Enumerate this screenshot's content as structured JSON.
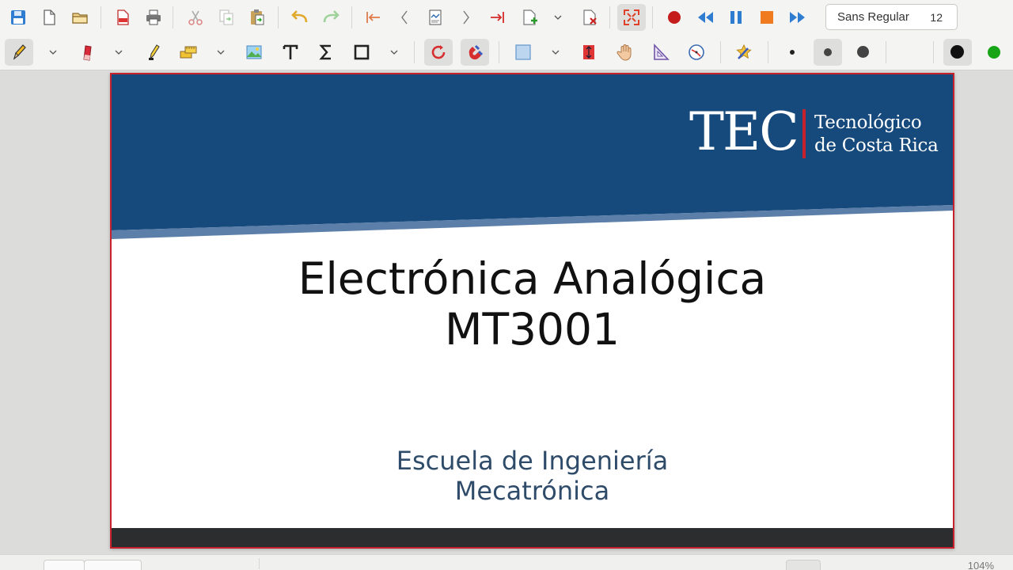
{
  "toolbar_top": {
    "items": [
      "save-icon",
      "new-page-icon",
      "open-folder-icon",
      "export-pdf-icon",
      "print-icon",
      "cut-icon",
      "copy-icon",
      "paste-icon",
      "undo-icon",
      "redo-icon",
      "first-page-icon",
      "previous-page-icon",
      "page-overview-icon",
      "next-page-icon",
      "last-page-icon",
      "add-page-icon",
      "delete-page-icon",
      "fullscreen-icon",
      "record-icon",
      "rewind-icon",
      "pause-icon",
      "stop-icon",
      "fast-forward-icon"
    ],
    "font_name": "Sans Regular",
    "font_size": "12"
  },
  "toolbar_tools": {
    "items": [
      "pen-icon",
      "eraser-icon",
      "highlighter-icon",
      "ruler-select-icon",
      "image-icon",
      "text-tool-icon",
      "formula-icon",
      "shape-icon",
      "rotate-snap-icon",
      "magnet-icon",
      "fill-rectangle-icon",
      "vertical-space-icon",
      "hand-icon",
      "set-square-icon",
      "compass-icon",
      "shape-recognizer-icon"
    ],
    "colors": {
      "purple": "#8f57e0",
      "black": "#111111",
      "green": "#17a517",
      "accent_red": "#c8212e"
    }
  },
  "slide": {
    "logo_letters": "TEC",
    "logo_name_line1": "Tecnológico",
    "logo_name_line2": "de Costa Rica",
    "title_line1": "Electrónica Analógica",
    "title_line2": "MT3001",
    "subtitle_line1": "Escuela de Ingeniería",
    "subtitle_line2": "Mecatrónica",
    "header_color": "#174a7c",
    "border_color": "#c8212e"
  },
  "statusbar": {
    "zoom": "104%"
  }
}
